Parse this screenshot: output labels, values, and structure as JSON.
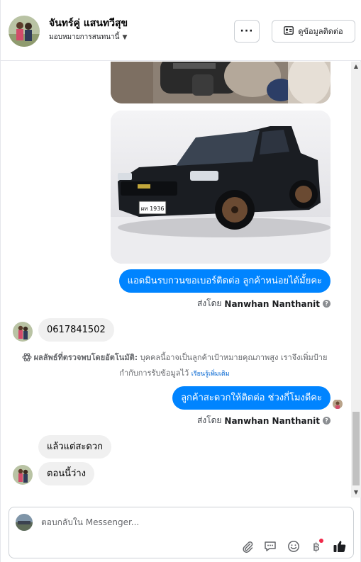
{
  "header": {
    "contact_name": "จันทร์คู่ แสนทวีสุข",
    "assign_label": "มอบหมายการสนทนานี้",
    "more_label": "···",
    "view_contact_label": "ดูข้อมูลติดต่อ"
  },
  "thread": {
    "message_admin_request": "แอดมินรบกวนขอเบอร์ติดต่อ ลูกค้าหน่อยได้มั้ยคะ",
    "sent_by_prefix": "ส่งโดย",
    "sent_by_name": "Nanwhan Nanthanit",
    "message_phone": "0617841502",
    "ai_note_bold": "ผลลัพธ์ที่ตรวจพบโดยอัตโนมัติ:",
    "ai_note_text": "บุคคลนี้อาจเป็นลูกค้าเป้าหมายคุณภาพสูง เราจึงเพิ่มป้ายกำกับการรับข้อมูลไว้",
    "ai_note_link": "เรียนรู้เพิ่มเติม",
    "message_ask_time": "ลูกค้าสะดวกให้ติดต่อ ช่วงกี่โมงดีคะ",
    "message_reply_1": "แล้วแต่สะดวก",
    "message_reply_2": "ตอนนี้ว่าง",
    "car_plate": "ผท 1936"
  },
  "composer": {
    "placeholder": "ตอบกลับใน Messenger..."
  },
  "icons": {
    "more": "more-horizontal-icon",
    "contact_card": "contact-card-icon",
    "info": "info-icon",
    "ai": "ai-sparkle-icon",
    "attach": "paperclip-icon",
    "saved_replies": "chat-bubble-icon",
    "emoji": "emoji-icon",
    "payment": "baht-icon",
    "like": "thumbs-up-icon"
  },
  "colors": {
    "accent": "#0084ff",
    "incoming_bubble": "#f0f0f0",
    "link": "#0064d1",
    "notification": "#f02849"
  }
}
